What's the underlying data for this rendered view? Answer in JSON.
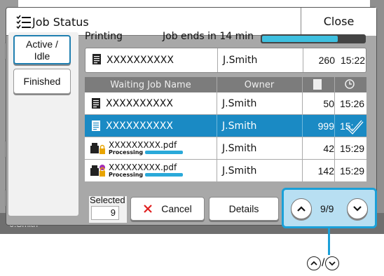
{
  "background": {
    "user_text": "J.Smith"
  },
  "title": "Job Status",
  "close_label": "Close",
  "tabs": {
    "active": [
      "Active /",
      "Idle"
    ],
    "finished": "Finished"
  },
  "printing": {
    "label": "Printing",
    "job_ends": "Job ends in 14 min",
    "progress": 0.74,
    "job": {
      "name": "XXXXXXXXXX",
      "owner": "J.Smith",
      "pages": "260",
      "time": "15:22"
    }
  },
  "table": {
    "headers": {
      "name": "Waiting Job Name",
      "owner": "Owner"
    },
    "rows": [
      {
        "name": "XXXXXXXXXX",
        "owner": "J.Smith",
        "pages": "50",
        "time": "15:26",
        "type": "doc",
        "selected": false
      },
      {
        "name": "XXXXXXXXXX",
        "owner": "J.Smith",
        "pages": "999",
        "time": "15:",
        "type": "doc",
        "selected": true
      },
      {
        "name": "XXXXXXXXX.pdf",
        "owner": "J.Smith",
        "pages": "42",
        "time": "15:29",
        "type": "pdf",
        "status": "Processing",
        "selected": false
      },
      {
        "name": "XXXXXXXXX.pdf",
        "owner": "J.Smith",
        "pages": "142",
        "time": "15:29",
        "type": "pdf-lock",
        "status": "Processing",
        "selected": false
      }
    ]
  },
  "selected": {
    "label": "Selected",
    "count": "9"
  },
  "buttons": {
    "cancel": "Cancel",
    "details": "Details"
  },
  "pager": {
    "count": "9/9"
  },
  "legend": {
    "separator": "/"
  },
  "colors": {
    "accent": "#1ba0d8",
    "selected_row": "#1a8ac4",
    "progress": "#3ec0e0"
  }
}
